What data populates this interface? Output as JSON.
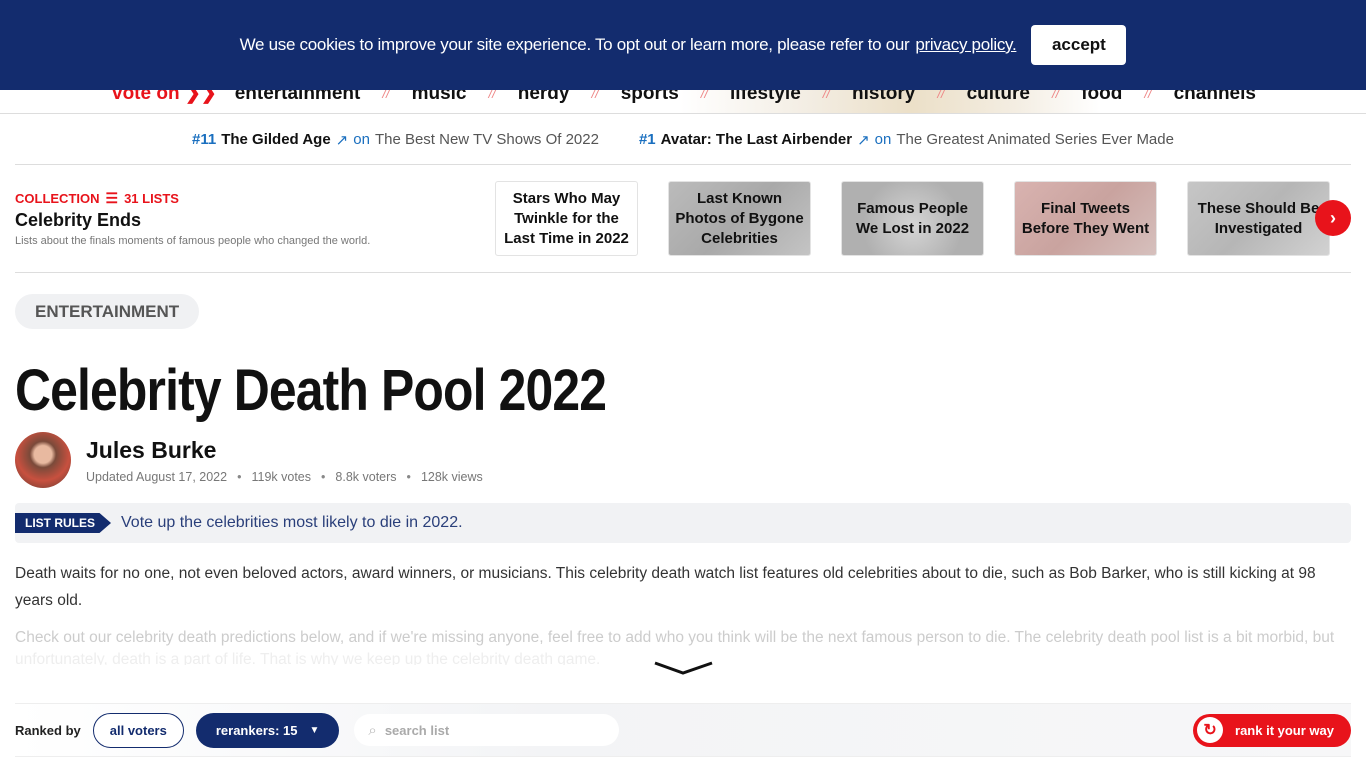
{
  "cookie_banner": {
    "message": "We use cookies to improve your site experience. To opt out or learn more, please refer to our",
    "link_label": "privacy policy.",
    "accept_label": "accept"
  },
  "nav": {
    "vote_on_label": "vote on",
    "vote_on_icon": "double-chevron-right",
    "separator": "//",
    "items": [
      "entertainment",
      "music",
      "nerdy",
      "sports",
      "lifestyle",
      "history",
      "culture",
      "food",
      "channels"
    ]
  },
  "trending": [
    {
      "rank": "#11",
      "title": "The Gilded Age",
      "icon": "trending-up",
      "on": "on",
      "list": "The Best New TV Shows Of 2022"
    },
    {
      "rank": "#1",
      "title": "Avatar: The Last Airbender",
      "icon": "trending-up",
      "on": "on",
      "list": "The Greatest Animated Series Ever Made"
    }
  ],
  "collection": {
    "label": "COLLECTION",
    "count": "31 LISTS",
    "title": "Celebrity Ends",
    "description": "Lists about the finals moments of famous people who changed the world.",
    "cards": [
      "Stars Who May Twinkle for the Last Time in 2022",
      "Last Known Photos of Bygone Celebrities",
      "Famous People We Lost in 2022",
      "Final Tweets Before They Went",
      "These Should Be Investigated"
    ]
  },
  "category": "ENTERTAINMENT",
  "page_title": "Celebrity Death Pool 2022",
  "author": {
    "name": "Jules Burke",
    "updated": "Updated August 17, 2022",
    "votes": "119k votes",
    "voters": "8.8k voters",
    "views": "128k views"
  },
  "rules": {
    "tag": "LIST RULES",
    "text": "Vote up the celebrities most likely to die in 2022."
  },
  "description": {
    "p1": "Death waits for no one, not even beloved actors, award winners, or musicians. This celebrity death watch list features old celebrities about to die, such as Bob Barker, who is still kicking at 98 years old.",
    "p2": "Check out our celebrity death predictions below, and if we're missing anyone, feel free to add who you think will be the next famous person to die. The celebrity death pool list is a bit morbid, but",
    "p3": "unfortunately, death is a part of life. That is why we keep up the celebrity death game."
  },
  "ranking_bar": {
    "ranked_by_label": "Ranked by",
    "all_voters_label": "all voters",
    "rerankers_label": "rerankers: 15",
    "search_placeholder": "search list",
    "rank_your_way_label": "rank it your way"
  },
  "colors": {
    "brand_navy": "#132c6e",
    "brand_red": "#e8131b",
    "link_blue": "#1a6fbf"
  }
}
